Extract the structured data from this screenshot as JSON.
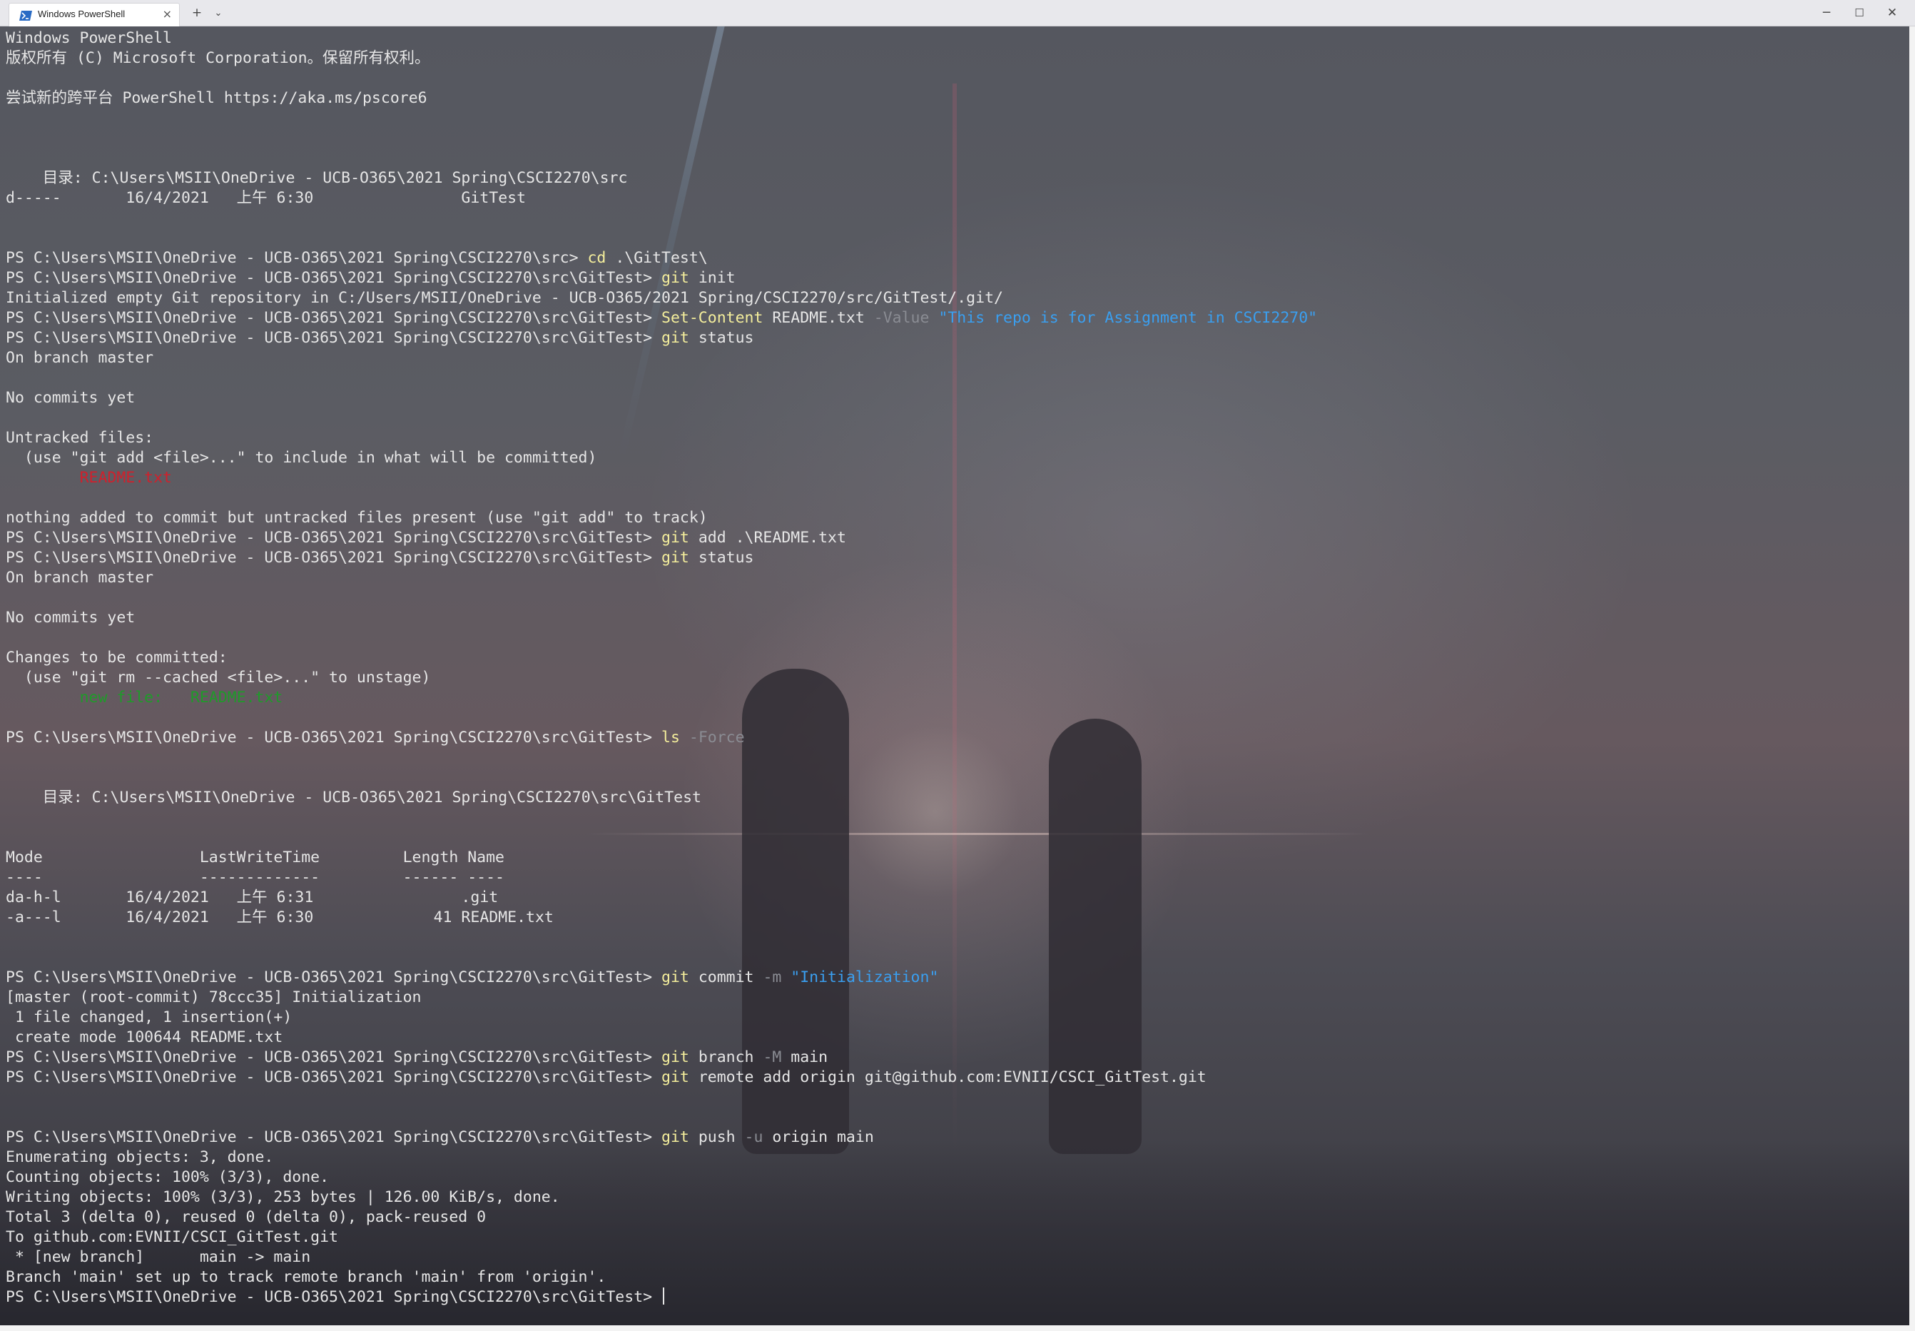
{
  "window": {
    "tab_title": "Windows PowerShell",
    "tab_close": "×",
    "new_tab": "+",
    "dropdown": "⌄",
    "minimize": "─",
    "maximize": "☐",
    "close": "✕"
  },
  "colors": {
    "default_text": "#e6e6e6",
    "command": "#f4ee9c",
    "parameter": "#8a8c93",
    "string": "#3a9ff0",
    "untracked": "#d0202c",
    "staged": "#1f9a2a"
  },
  "terminal": {
    "lines": [
      [
        {
          "t": "Windows PowerShell"
        }
      ],
      [
        {
          "t": "版权所有 (C) Microsoft Corporation。保留所有权利。"
        }
      ],
      [
        {
          "t": ""
        }
      ],
      [
        {
          "t": "尝试新的跨平台 PowerShell https://aka.ms/pscore6"
        }
      ],
      [
        {
          "t": ""
        }
      ],
      [
        {
          "t": ""
        }
      ],
      [
        {
          "t": ""
        }
      ],
      [
        {
          "t": "    目录: C:\\Users\\MSII\\OneDrive - UCB-O365\\2021 Spring\\CSCI2270\\src"
        }
      ],
      [
        {
          "t": "d-----       16/4/2021   上午 6:30                GitTest"
        }
      ],
      [
        {
          "t": ""
        }
      ],
      [
        {
          "t": ""
        }
      ],
      [
        {
          "t": "PS C:\\Users\\MSII\\OneDrive - UCB-O365\\2021 Spring\\CSCI2270\\src> "
        },
        {
          "t": "cd",
          "c": "cmd"
        },
        {
          "t": " .\\GitTest\\"
        }
      ],
      [
        {
          "t": "PS C:\\Users\\MSII\\OneDrive - UCB-O365\\2021 Spring\\CSCI2270\\src\\GitTest> "
        },
        {
          "t": "git",
          "c": "cmd"
        },
        {
          "t": " init"
        }
      ],
      [
        {
          "t": "Initialized empty Git repository in C:/Users/MSII/OneDrive - UCB-O365/2021 Spring/CSCI2270/src/GitTest/.git/"
        }
      ],
      [
        {
          "t": "PS C:\\Users\\MSII\\OneDrive - UCB-O365\\2021 Spring\\CSCI2270\\src\\GitTest> "
        },
        {
          "t": "Set-Content",
          "c": "cmd"
        },
        {
          "t": " README.txt "
        },
        {
          "t": "-Value",
          "c": "param"
        },
        {
          "t": " "
        },
        {
          "t": "\"This repo is for Assignment in CSCI2270\"",
          "c": "str"
        }
      ],
      [
        {
          "t": "PS C:\\Users\\MSII\\OneDrive - UCB-O365\\2021 Spring\\CSCI2270\\src\\GitTest> "
        },
        {
          "t": "git",
          "c": "cmd"
        },
        {
          "t": " status"
        }
      ],
      [
        {
          "t": "On branch master"
        }
      ],
      [
        {
          "t": ""
        }
      ],
      [
        {
          "t": "No commits yet"
        }
      ],
      [
        {
          "t": ""
        }
      ],
      [
        {
          "t": "Untracked files:"
        }
      ],
      [
        {
          "t": "  (use \"git add <file>...\" to include in what will be committed)"
        }
      ],
      [
        {
          "t": "        "
        },
        {
          "t": "README.txt",
          "c": "red"
        }
      ],
      [
        {
          "t": ""
        }
      ],
      [
        {
          "t": "nothing added to commit but untracked files present (use \"git add\" to track)"
        }
      ],
      [
        {
          "t": "PS C:\\Users\\MSII\\OneDrive - UCB-O365\\2021 Spring\\CSCI2270\\src\\GitTest> "
        },
        {
          "t": "git",
          "c": "cmd"
        },
        {
          "t": " add .\\README.txt"
        }
      ],
      [
        {
          "t": "PS C:\\Users\\MSII\\OneDrive - UCB-O365\\2021 Spring\\CSCI2270\\src\\GitTest> "
        },
        {
          "t": "git",
          "c": "cmd"
        },
        {
          "t": " status"
        }
      ],
      [
        {
          "t": "On branch master"
        }
      ],
      [
        {
          "t": ""
        }
      ],
      [
        {
          "t": "No commits yet"
        }
      ],
      [
        {
          "t": ""
        }
      ],
      [
        {
          "t": "Changes to be committed:"
        }
      ],
      [
        {
          "t": "  (use \"git rm --cached <file>...\" to unstage)"
        }
      ],
      [
        {
          "t": "        "
        },
        {
          "t": "new file:   README.txt",
          "c": "green"
        }
      ],
      [
        {
          "t": ""
        }
      ],
      [
        {
          "t": "PS C:\\Users\\MSII\\OneDrive - UCB-O365\\2021 Spring\\CSCI2270\\src\\GitTest> "
        },
        {
          "t": "ls",
          "c": "cmd"
        },
        {
          "t": " "
        },
        {
          "t": "-Force",
          "c": "param"
        }
      ],
      [
        {
          "t": ""
        }
      ],
      [
        {
          "t": ""
        }
      ],
      [
        {
          "t": "    目录: C:\\Users\\MSII\\OneDrive - UCB-O365\\2021 Spring\\CSCI2270\\src\\GitTest"
        }
      ],
      [
        {
          "t": ""
        }
      ],
      [
        {
          "t": ""
        }
      ],
      [
        {
          "t": "Mode                 LastWriteTime         Length Name"
        }
      ],
      [
        {
          "t": "----                 -------------         ------ ----"
        }
      ],
      [
        {
          "t": "da-h-l       16/4/2021   上午 6:31                .git"
        }
      ],
      [
        {
          "t": "-a---l       16/4/2021   上午 6:30             41 README.txt"
        }
      ],
      [
        {
          "t": ""
        }
      ],
      [
        {
          "t": ""
        }
      ],
      [
        {
          "t": "PS C:\\Users\\MSII\\OneDrive - UCB-O365\\2021 Spring\\CSCI2270\\src\\GitTest> "
        },
        {
          "t": "git",
          "c": "cmd"
        },
        {
          "t": " commit "
        },
        {
          "t": "-m",
          "c": "param"
        },
        {
          "t": " "
        },
        {
          "t": "\"Initialization\"",
          "c": "str"
        }
      ],
      [
        {
          "t": "[master (root-commit) 78ccc35] Initialization"
        }
      ],
      [
        {
          "t": " 1 file changed, 1 insertion(+)"
        }
      ],
      [
        {
          "t": " create mode 100644 README.txt"
        }
      ],
      [
        {
          "t": "PS C:\\Users\\MSII\\OneDrive - UCB-O365\\2021 Spring\\CSCI2270\\src\\GitTest> "
        },
        {
          "t": "git",
          "c": "cmd"
        },
        {
          "t": " branch "
        },
        {
          "t": "-M",
          "c": "param"
        },
        {
          "t": " main"
        }
      ],
      [
        {
          "t": "PS C:\\Users\\MSII\\OneDrive - UCB-O365\\2021 Spring\\CSCI2270\\src\\GitTest> "
        },
        {
          "t": "git",
          "c": "cmd"
        },
        {
          "t": " remote add origin git@github.com:EVNII/CSCI_GitTest.git"
        }
      ],
      [
        {
          "t": ""
        }
      ],
      [
        {
          "t": ""
        }
      ],
      [
        {
          "t": "PS C:\\Users\\MSII\\OneDrive - UCB-O365\\2021 Spring\\CSCI2270\\src\\GitTest> "
        },
        {
          "t": "git",
          "c": "cmd"
        },
        {
          "t": " push "
        },
        {
          "t": "-u",
          "c": "param"
        },
        {
          "t": " origin main"
        }
      ],
      [
        {
          "t": "Enumerating objects: 3, done."
        }
      ],
      [
        {
          "t": "Counting objects: 100% (3/3), done."
        }
      ],
      [
        {
          "t": "Writing objects: 100% (3/3), 253 bytes | 126.00 KiB/s, done."
        }
      ],
      [
        {
          "t": "Total 3 (delta 0), reused 0 (delta 0), pack-reused 0"
        }
      ],
      [
        {
          "t": "To github.com:EVNII/CSCI_GitTest.git"
        }
      ],
      [
        {
          "t": " * [new branch]      main -> main"
        }
      ],
      [
        {
          "t": "Branch 'main' set up to track remote branch 'main' from 'origin'."
        }
      ],
      [
        {
          "t": "PS C:\\Users\\MSII\\OneDrive - UCB-O365\\2021 Spring\\CSCI2270\\src\\GitTest> "
        }
      ]
    ]
  }
}
